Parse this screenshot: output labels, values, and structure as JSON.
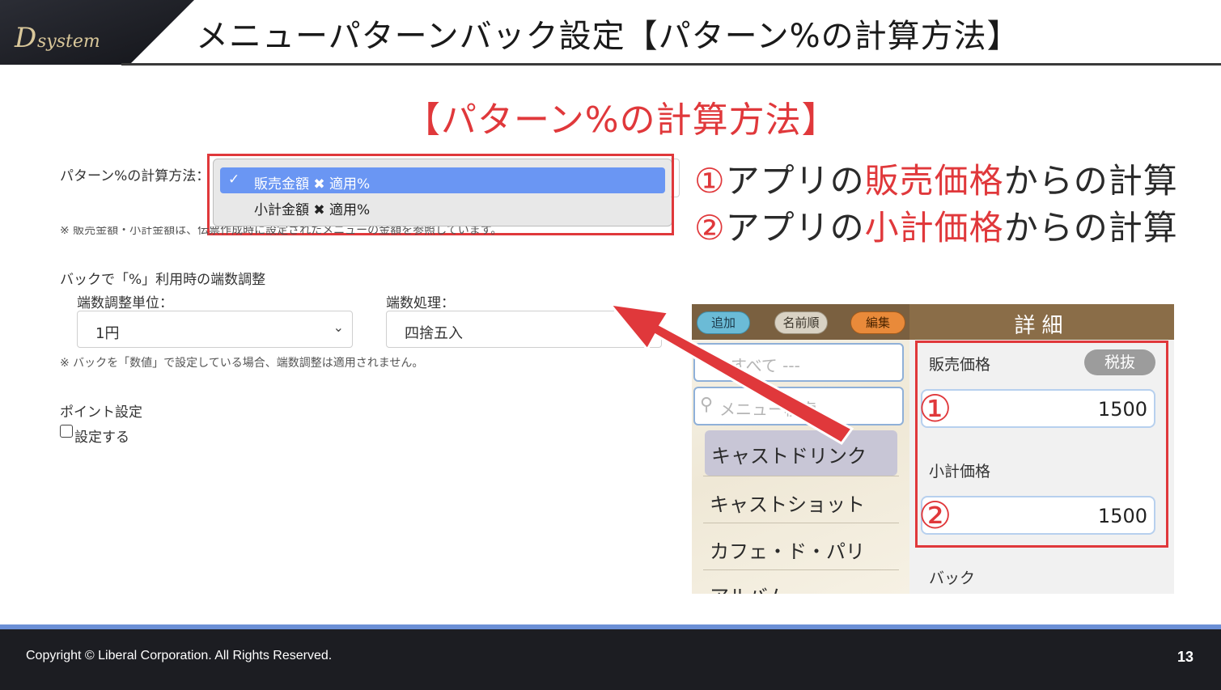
{
  "header": {
    "logo_text": "Dsystem",
    "title": "メニューパターンバック設定【パターン%の計算方法】"
  },
  "main_title": "【パターン%の計算方法】",
  "form": {
    "calc_method_label": "パターン%の計算方法：",
    "dropdown": {
      "options": [
        {
          "label": "販売金額 ✖ 適用%",
          "selected": true
        },
        {
          "label": "小計金額 ✖ 適用%",
          "selected": false
        }
      ]
    },
    "note_1": "※ 販売金額・小計金額は、伝票作成時に設定されたメニューの金額を参照しています。",
    "rounding_section_label": "バックで「%」利用時の端数調整",
    "rounding_unit_label": "端数調整単位：",
    "rounding_unit_value": "1円",
    "rounding_process_label": "端数処理：",
    "rounding_process_value": "四捨五入",
    "note_2": "※ バックを「数値」で設定している場合、端数調整は適用されません。",
    "point_section_label": "ポイント設定",
    "point_checkbox_label": "設定する"
  },
  "annotations": [
    {
      "number": "①",
      "prefix": "アプリの",
      "highlight": "販売価格",
      "suffix": "からの計算"
    },
    {
      "number": "②",
      "prefix": "アプリの",
      "highlight": "小計価格",
      "suffix": "からの計算"
    }
  ],
  "app": {
    "buttons": {
      "add": "追加",
      "sort": "名前順",
      "edit": "編集"
    },
    "detail_title": "詳細",
    "filter_text": "すべて ---",
    "search_placeholder": "メニュー検索",
    "categories": [
      "キャストドリンク",
      "キャストショット",
      "カフェ・ド・パリ",
      "アルバム"
    ],
    "sale_price_label": "販売価格",
    "tax_label": "税抜",
    "sale_price_value": "1500",
    "subtotal_label": "小計価格",
    "subtotal_value": "1500",
    "back_label": "バック",
    "marker_1": "①",
    "marker_2": "②"
  },
  "footer": {
    "copyright": "Copyright ©  Liberal Corporation. All Rights Reserved.",
    "page_number": "13"
  },
  "colors": {
    "accent_red": "#e0383b",
    "select_blue": "#6a96f3",
    "footer_bg": "#1c1d22"
  }
}
